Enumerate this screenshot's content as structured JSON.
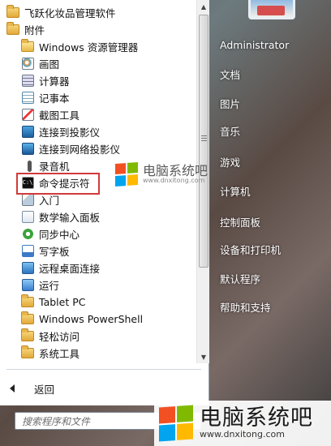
{
  "programs": [
    {
      "label": "飞跃化妆品管理软件",
      "icon": "folder-icon",
      "level": 0
    },
    {
      "label": "附件",
      "icon": "folder-icon",
      "level": 0
    },
    {
      "label": "Windows 资源管理器",
      "icon": "explorer-icon",
      "level": 1
    },
    {
      "label": "画图",
      "icon": "paint-icon",
      "level": 1
    },
    {
      "label": "计算器",
      "icon": "calculator-icon",
      "level": 1
    },
    {
      "label": "记事本",
      "icon": "notepad-icon",
      "level": 1
    },
    {
      "label": "截图工具",
      "icon": "snipping-tool-icon",
      "level": 1
    },
    {
      "label": "连接到投影仪",
      "icon": "projector-icon",
      "level": 1
    },
    {
      "label": "连接到网络投影仪",
      "icon": "network-projector-icon",
      "level": 1
    },
    {
      "label": "录音机",
      "icon": "microphone-icon",
      "level": 1
    },
    {
      "label": "命令提示符",
      "icon": "cmd-icon",
      "level": 1
    },
    {
      "label": "入门",
      "icon": "getting-started-icon",
      "level": 1
    },
    {
      "label": "数学输入面板",
      "icon": "math-input-icon",
      "level": 1
    },
    {
      "label": "同步中心",
      "icon": "sync-center-icon",
      "level": 1
    },
    {
      "label": "写字板",
      "icon": "wordpad-icon",
      "level": 1
    },
    {
      "label": "远程桌面连接",
      "icon": "remote-desktop-icon",
      "level": 1
    },
    {
      "label": "运行",
      "icon": "run-icon",
      "level": 1
    },
    {
      "label": "Tablet PC",
      "icon": "folder-icon",
      "level": 1
    },
    {
      "label": "Windows PowerShell",
      "icon": "folder-icon",
      "level": 1
    },
    {
      "label": "轻松访问",
      "icon": "folder-icon",
      "level": 1
    },
    {
      "label": "系统工具",
      "icon": "folder-icon",
      "level": 1
    }
  ],
  "highlighted_item": "命令提示符",
  "back_label": "返回",
  "search": {
    "placeholder": "搜索程序和文件"
  },
  "right_links": [
    "Administrator",
    "文档",
    "图片",
    "音乐",
    "游戏",
    "计算机",
    "控制面板",
    "设备和打印机",
    "默认程序",
    "帮助和支持"
  ],
  "watermark_mid": {
    "title": "电脑系统吧",
    "url": "www.dnxitong.com"
  },
  "watermark_bottom": {
    "title": "电脑系统吧",
    "url": "www.dnxitong.com"
  },
  "colors": {
    "highlight_border": "#d23a3a",
    "logo_red": "#f25022",
    "logo_green": "#7fba00",
    "logo_blue": "#00a4ef",
    "logo_yellow": "#ffb900"
  }
}
